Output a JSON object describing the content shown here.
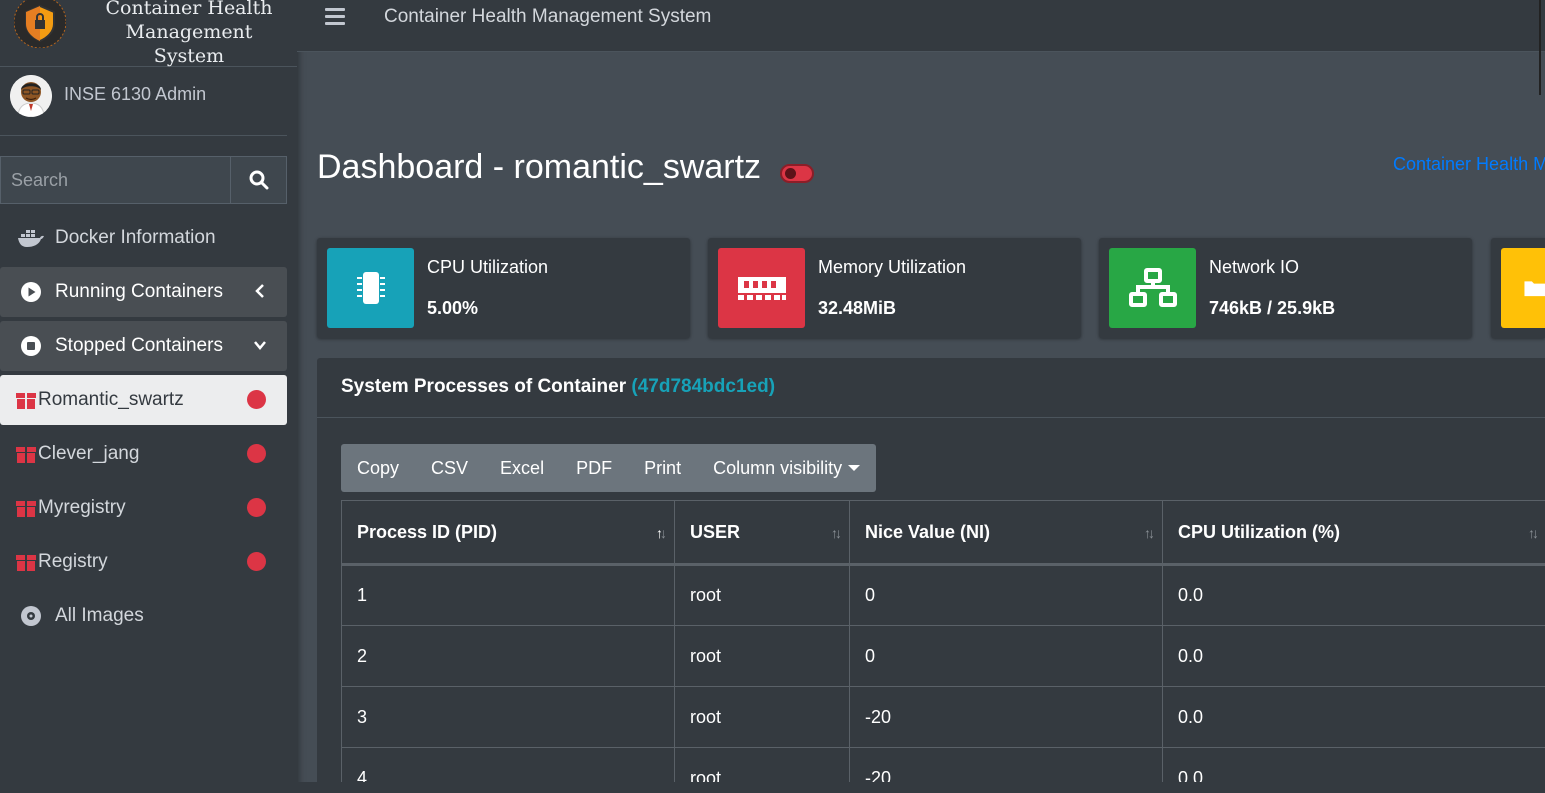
{
  "brand": {
    "line1": "Container Health",
    "line2": "Management System"
  },
  "user": {
    "name": "INSE 6130 Admin"
  },
  "search": {
    "placeholder": "Search"
  },
  "sidebar": {
    "items": [
      {
        "label": "Docker Information",
        "icon": "docker-icon"
      },
      {
        "label": "Running Containers",
        "icon": "play-circle-icon",
        "caret": "left"
      },
      {
        "label": "Stopped Containers",
        "icon": "stop-circle-icon",
        "caret": "down"
      },
      {
        "label": "Romantic_swartz",
        "icon": "box-icon",
        "status": "stopped",
        "active": true
      },
      {
        "label": "Clever_jang",
        "icon": "box-icon",
        "status": "stopped"
      },
      {
        "label": "Myregistry",
        "icon": "box-icon",
        "status": "stopped"
      },
      {
        "label": "Registry",
        "icon": "box-icon",
        "status": "stopped"
      },
      {
        "label": "All Images",
        "icon": "disc-icon"
      }
    ]
  },
  "topbar": {
    "title": "Container Health Management System"
  },
  "page": {
    "title": "Dashboard - romantic_swartz",
    "breadcrumb": "Container Health M"
  },
  "info_boxes": [
    {
      "label": "CPU Utilization",
      "value": "5.00%",
      "color": "#17a2b8",
      "icon": "microchip-icon"
    },
    {
      "label": "Memory Utilization",
      "value": "32.48MiB",
      "color": "#dc3545",
      "icon": "memory-icon"
    },
    {
      "label": "Network IO",
      "value": "746kB / 25.9kB",
      "color": "#28a745",
      "icon": "network-icon"
    },
    {
      "label": "",
      "value": "",
      "color": "#ffc107",
      "icon": "folder-icon"
    }
  ],
  "processes": {
    "title": "System Processes of Container",
    "container_id": "(47d784bdc1ed)",
    "buttons": [
      "Copy",
      "CSV",
      "Excel",
      "PDF",
      "Print",
      "Column visibility"
    ],
    "columns": [
      "Process ID (PID)",
      "USER",
      "Nice Value (NI)",
      "CPU Utilization (%)"
    ],
    "rows": [
      [
        "1",
        "root",
        "0",
        "0.0"
      ],
      [
        "2",
        "root",
        "0",
        "0.0"
      ],
      [
        "3",
        "root",
        "-20",
        "0.0"
      ],
      [
        "4",
        "root",
        "-20",
        "0.0"
      ]
    ]
  },
  "colors": {
    "accent": "#007bff",
    "danger": "#dc3545",
    "info": "#17a2b8",
    "success": "#28a745",
    "warning": "#ffc107"
  }
}
